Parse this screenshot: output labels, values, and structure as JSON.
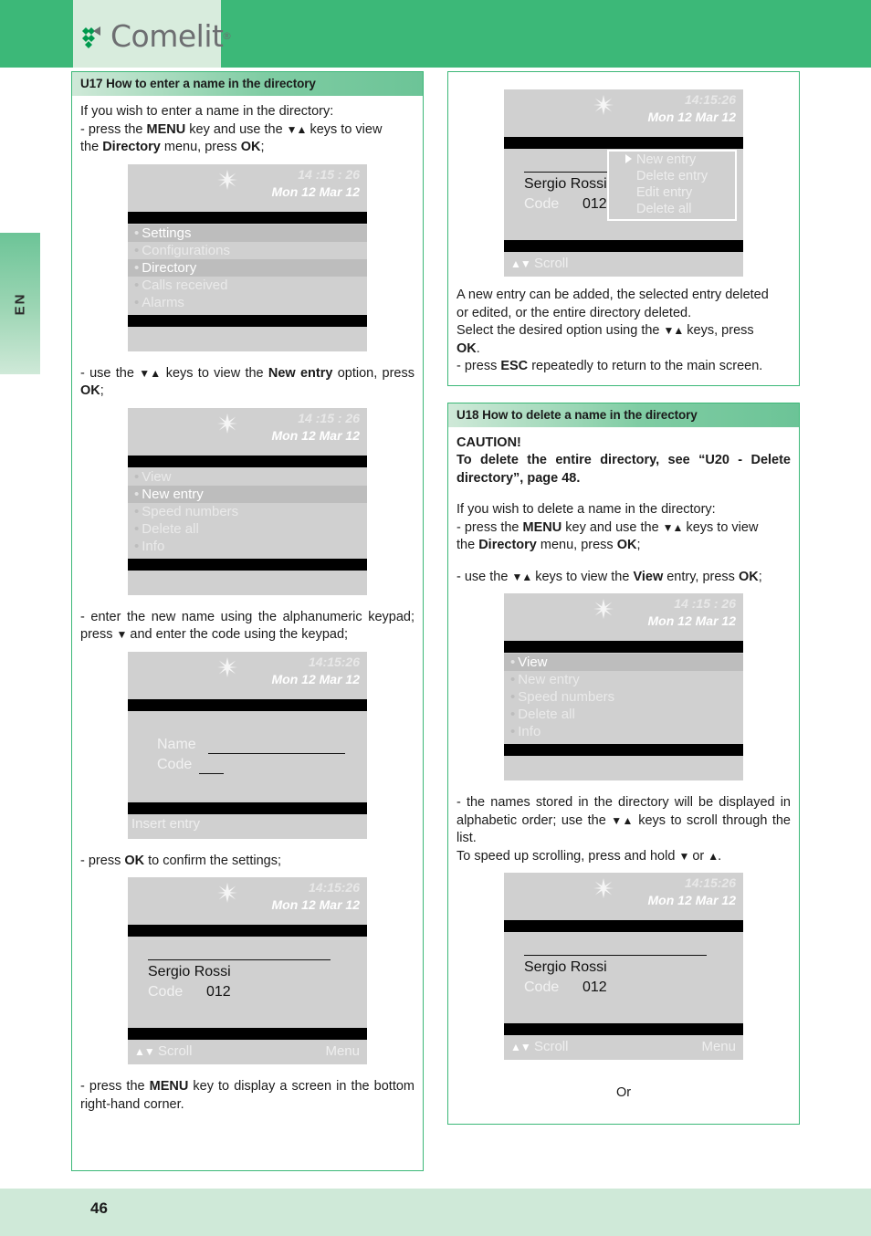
{
  "brand": {
    "name": "Comelit",
    "registered_mark": "®",
    "green": "#3cb878"
  },
  "language_tab": {
    "label": "EN"
  },
  "footer": {
    "page_number": "46"
  },
  "sections": {
    "u17": {
      "title": "U17 How to enter a name in the directory",
      "para1_line1": "If you wish to enter a name in the directory:",
      "para1_line2_a": "- press the ",
      "para1_line2_menu": "MENU",
      "para1_line2_b": " key and use the ",
      "para1_line2_arrows": "▼▲",
      "para1_line2_c": " keys to view",
      "para1_line3_a": "the ",
      "para1_line3_dir": "Directory",
      "para1_line3_b": " menu, press ",
      "para1_line3_ok": "OK",
      "para1_line3_c": ";",
      "para2_a": "- use the ",
      "para2_arrows": "▼▲",
      "para2_b": " keys to view the ",
      "para2_newentry": "New entry",
      "para2_c": " option, press ",
      "para2_ok": "OK",
      "para2_d": ";",
      "para3_a": "- enter the new name using the alphanumeric keypad; press ",
      "para3_arrow": "▼",
      "para3_b": " and enter the code using the keypad;",
      "para4_a": "- press ",
      "para4_ok": "OK",
      "para4_b": " to confirm the settings;",
      "para5_a": "- press the ",
      "para5_menu": "MENU",
      "para5_b": " key to display a screen in the bottom right-hand corner."
    },
    "u17_right": {
      "para1_line1": "A new entry can be added, the selected entry deleted",
      "para1_line2": "or edited, or the entire directory deleted.",
      "para2_a": "Select the desired option using the ",
      "para2_arrows": "▼▲",
      "para2_b": " keys, press ",
      "para2_ok": "OK",
      "para2_c": ".",
      "para3_a": "- press ",
      "para3_esc": "ESC",
      "para3_b": " repeatedly to return to the main screen."
    },
    "u18": {
      "title": "U18 How to delete a name in the directory",
      "caution_label": "CAUTION!",
      "caution_text": "To delete the entire directory, see “U20 - Delete directory”, page 48.",
      "para1_line1": "If you wish to delete a name in the directory:",
      "para1_line2_a": "- press the ",
      "para1_line2_menu": "MENU",
      "para1_line2_b": " key and use the ",
      "para1_line2_arrows": "▼▲",
      "para1_line2_c": " keys to view",
      "para1_line3_a": "the ",
      "para1_line3_dir": "Directory",
      "para1_line3_b": " menu, press ",
      "para1_line3_ok": "OK",
      "para1_line3_c": ";",
      "para2_a": "- use the ",
      "para2_arrows": "▼▲",
      "para2_b": " keys to view the ",
      "para2_view": "View",
      "para2_c": " entry, press ",
      "para2_ok": "OK",
      "para2_d": ";",
      "para3_a": "- the names stored in the directory will be displayed in alphabetic order; use the ",
      "para3_arrows": "▼▲",
      "para3_b": " keys to scroll through the list.",
      "para4_a": "To speed up scrolling, press and hold ",
      "para4_down": "▼",
      "para4_b": " or ",
      "para4_up": "▲",
      "para4_c": ".",
      "or_text": "Or"
    }
  },
  "screens": {
    "main_menu": {
      "time": "14 :15 : 26",
      "date": "Mon 12 Mar 12",
      "items": [
        {
          "label": "Settings",
          "selected": false
        },
        {
          "label": "Configurations",
          "selected": false
        },
        {
          "label": "Directory",
          "selected": true
        },
        {
          "label": "Calls received",
          "selected": false
        },
        {
          "label": "Alarms",
          "selected": false
        }
      ]
    },
    "directory_menu_newentry": {
      "time": "14 :15 : 26",
      "date": "Mon 12 Mar 12",
      "items": [
        {
          "label": "View",
          "selected": false
        },
        {
          "label": "New entry",
          "selected": true
        },
        {
          "label": "Speed numbers",
          "selected": false
        },
        {
          "label": "Delete all",
          "selected": false
        },
        {
          "label": "Info",
          "selected": false
        }
      ]
    },
    "insert_entry": {
      "time": "14:15:26",
      "date": "Mon 12 Mar 12",
      "name_label": "Name",
      "name_value": "",
      "code_label": "Code",
      "code_value": "",
      "footer_text": "Insert entry"
    },
    "entry_saved": {
      "time": "14:15:26",
      "date": "Mon 12 Mar 12",
      "name": "Sergio Rossi",
      "code_label": "Code",
      "code_value": "012",
      "scroll_arrows": "▲▼",
      "scroll_label": "Scroll",
      "menu_label": "Menu"
    },
    "entry_with_popup": {
      "time": "14:15:26",
      "date": "Mon 12 Mar 12",
      "name": "Sergio Rossi",
      "code_label": "Code",
      "code_value": "012",
      "scroll_arrows": "▲▼",
      "scroll_label": "Scroll",
      "popup_items": [
        {
          "label": "New entry",
          "selected": true
        },
        {
          "label": "Delete entry",
          "selected": false
        },
        {
          "label": "Edit entry",
          "selected": false
        },
        {
          "label": "Delete all",
          "selected": false
        }
      ]
    },
    "directory_menu_view": {
      "time": "14 :15 : 26",
      "date": "Mon 12 Mar 12",
      "items": [
        {
          "label": "View",
          "selected": true
        },
        {
          "label": "New entry",
          "selected": false
        },
        {
          "label": "Speed numbers",
          "selected": false
        },
        {
          "label": "Delete all",
          "selected": false
        },
        {
          "label": "Info",
          "selected": false
        }
      ]
    },
    "entry_view": {
      "time": "14:15:26",
      "date": "Mon 12 Mar 12",
      "name": "Sergio Rossi",
      "code_label": "Code",
      "code_value": "012",
      "scroll_arrows": "▲▼",
      "scroll_label": "Scroll",
      "menu_label": "Menu"
    }
  }
}
